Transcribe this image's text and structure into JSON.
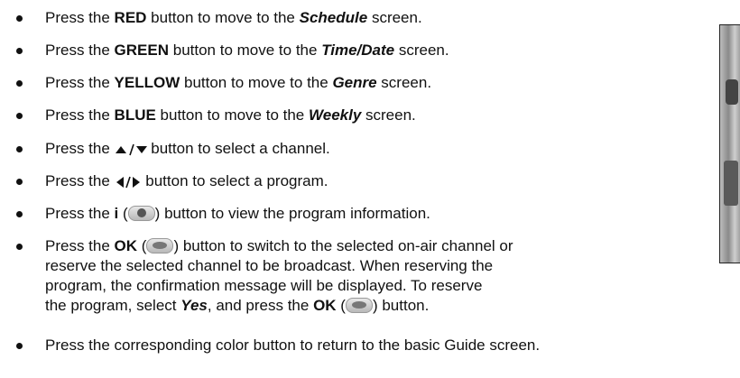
{
  "items": [
    {
      "pre": "Press the ",
      "key": "RED",
      "mid": " button to move to the ",
      "target": "Schedule",
      "post": " screen."
    },
    {
      "pre": "Press the ",
      "key": "GREEN",
      "mid": " button to move to the ",
      "target": "Time/Date",
      "post": " screen."
    },
    {
      "pre": "Press the ",
      "key": "YELLOW",
      "mid": " button to move to the ",
      "target": "Genre",
      "post": " screen."
    },
    {
      "pre": "Press the ",
      "key": "BLUE",
      "mid": " button to move to the ",
      "target": "Weekly",
      "post": " screen."
    },
    {
      "pre": "Press the ",
      "post": " button to select a channel."
    },
    {
      "pre": "Press the ",
      "post": " button to select a program."
    },
    {
      "pre": "Press the ",
      "key": "i",
      "open": " (",
      "close": ")",
      "post": " button to view the program information."
    },
    {
      "pre": "Press the ",
      "key": "OK",
      "open": " (",
      "close": ")",
      "post": " button to switch to the selected on-air channel or",
      "line2": "reserve the selected channel to be broadcast. When reserving the",
      "line3": "program, the confirmation message will be displayed. To reserve",
      "line4_pre": "the program, select ",
      "line4_yes": "Yes",
      "line4_mid": ", and press the ",
      "line4_ok": "OK",
      "line4_open": " (",
      "line4_close": ")",
      "line4_post": " button."
    },
    {
      "text": "Press the corresponding color button to return to the basic Guide screen."
    }
  ],
  "icons": {
    "up_down": "up-down-arrow-icon",
    "left_right": "left-right-arrow-icon",
    "info": "info-button-icon",
    "ok": "ok-button-icon"
  }
}
